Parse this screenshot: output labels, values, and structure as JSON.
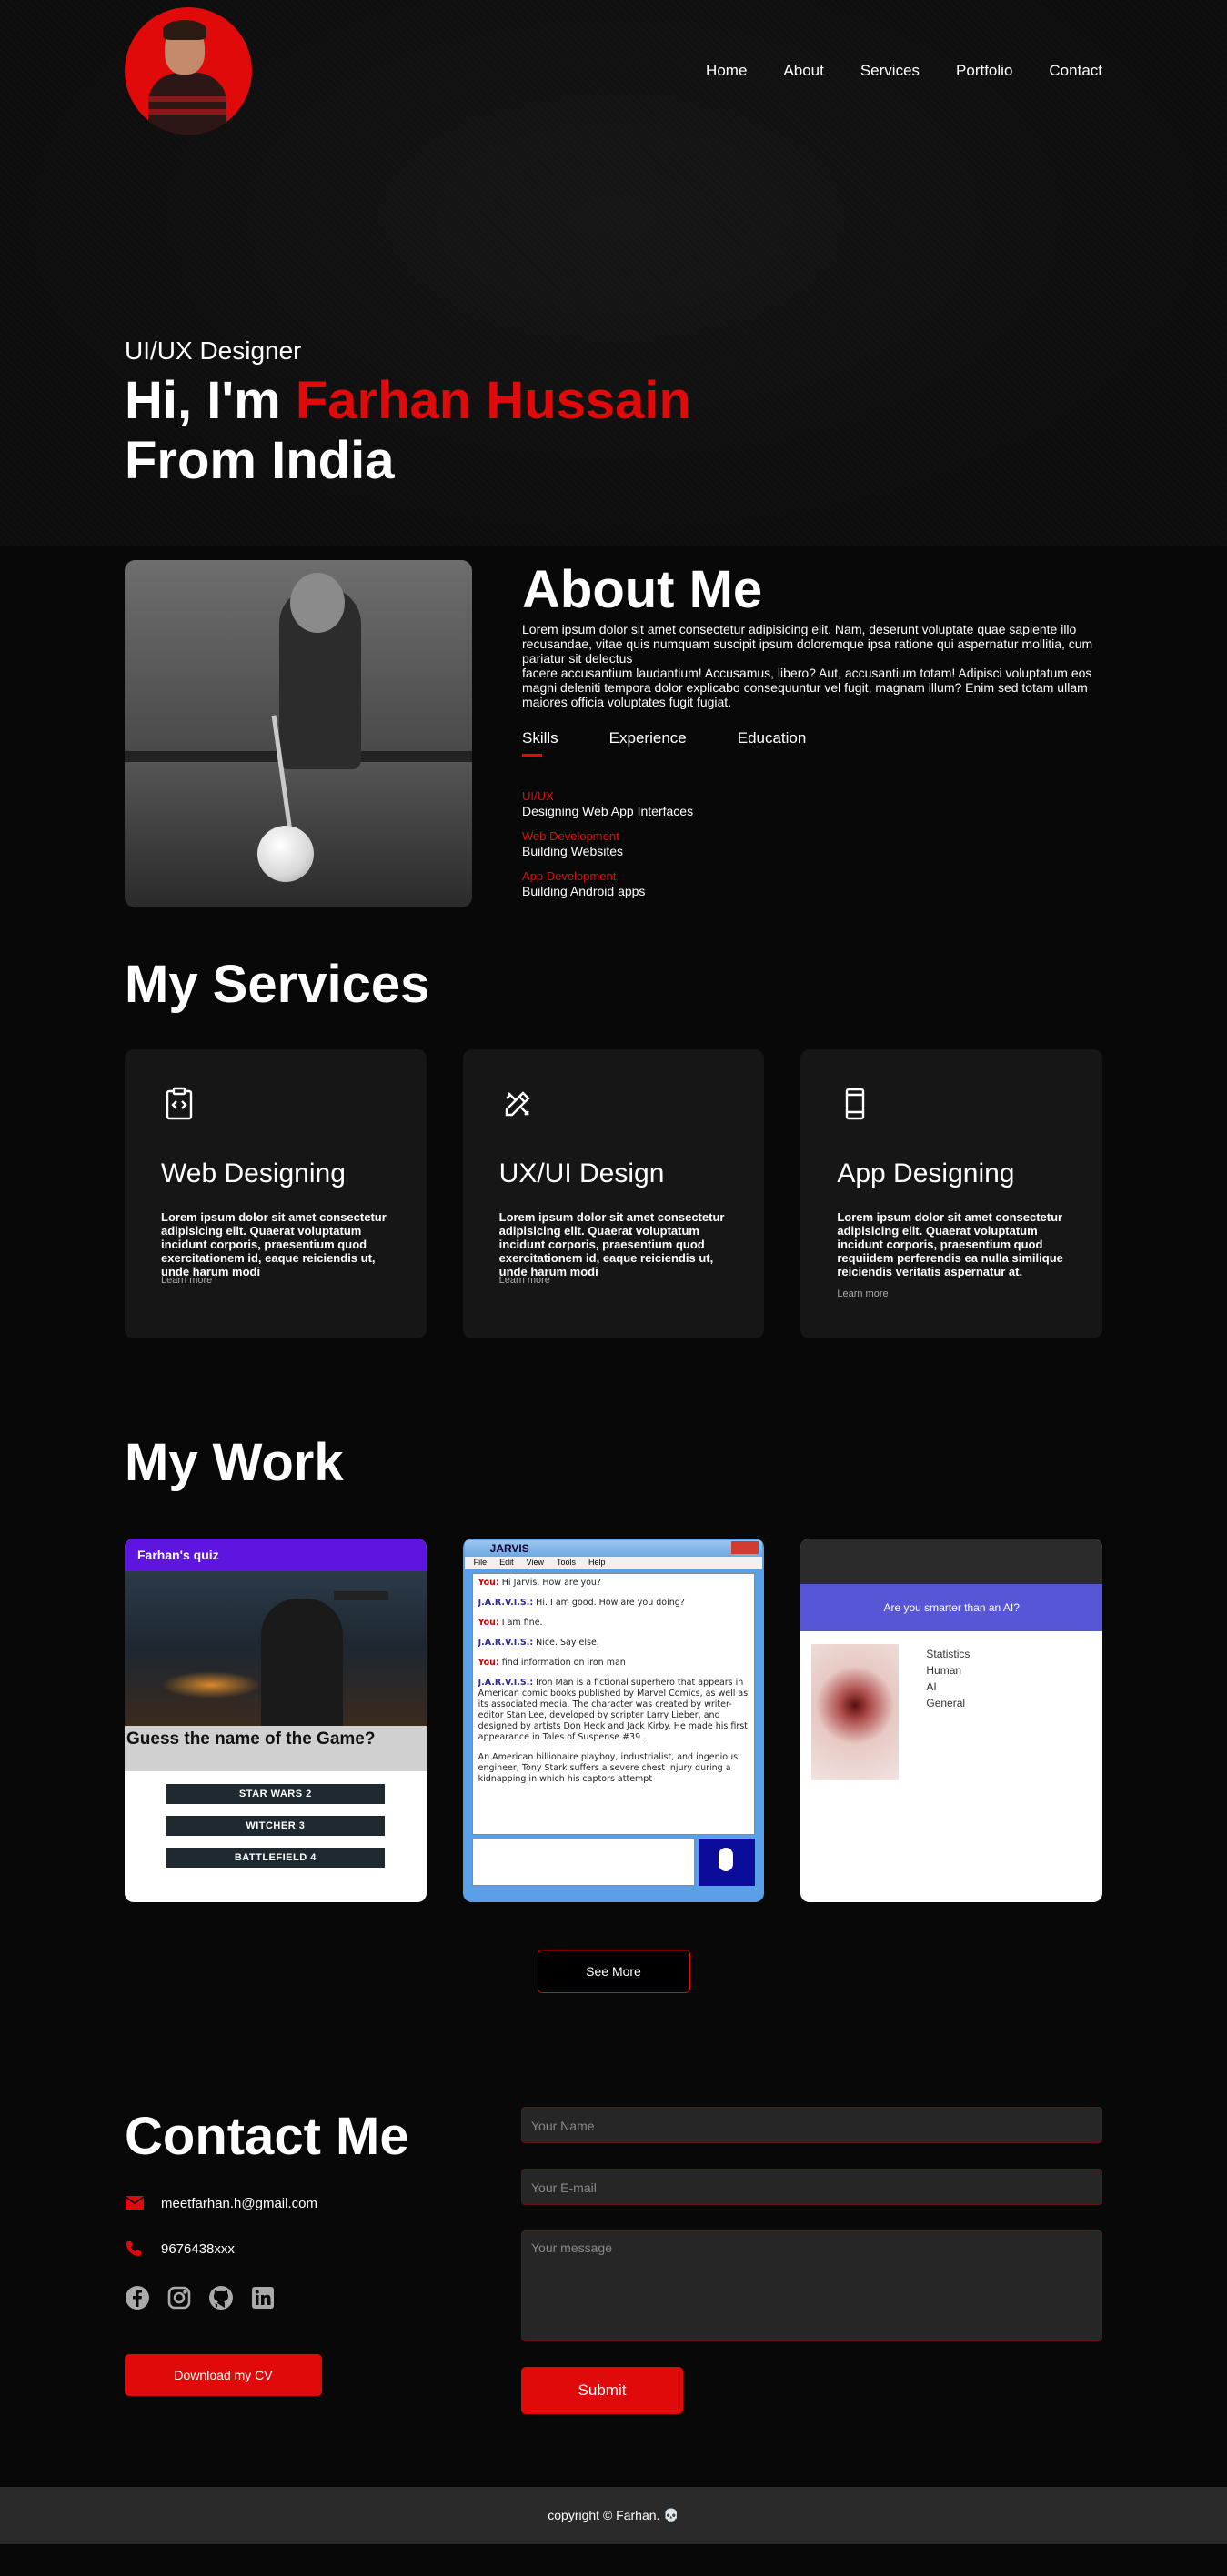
{
  "nav": {
    "items": [
      "Home",
      "About",
      "Services",
      "Portfolio",
      "Contact"
    ]
  },
  "hero": {
    "role": "UI/UX Designer",
    "greeting": "Hi, I'm ",
    "name": "Farhan Hussain",
    "location": "From India"
  },
  "about": {
    "title": "About Me",
    "text": "Lorem ipsum dolor sit amet consectetur adipisicing elit. Nam, deserunt voluptate quae sapiente illo recusandae, vitae quis numquam suscipit ipsum doloremque ipsa ratione qui aspernatur mollitia, cum pariatur sit delectus\nfacere accusantium laudantium! Accusamus, libero? Aut, accusantium totam! Adipisci voluptatum eos magni deleniti tempora dolor explicabo consequuntur vel fugit, magnam illum? Enim sed totam ullam maiores officia voluptates fugit fugiat.",
    "tabs": [
      "Skills",
      "Experience",
      "Education"
    ],
    "skills": [
      {
        "title": "UI/UX",
        "desc": "Designing Web App Interfaces"
      },
      {
        "title": "Web Development",
        "desc": "Building Websites"
      },
      {
        "title": "App Development",
        "desc": "Building Android apps"
      }
    ]
  },
  "services": {
    "title": "My Services",
    "cards": [
      {
        "icon": "code-file-icon",
        "title": "Web Designing",
        "text": "Lorem ipsum dolor sit amet consectetur adipisicing elit. Quaerat voluptatum incidunt corporis, praesentium quod exercitationem id, eaque reiciendis ut, unde harum modi",
        "link": "Learn more"
      },
      {
        "icon": "design-tools-icon",
        "title": "UX/UI Design",
        "text": "Lorem ipsum dolor sit amet consectetur adipisicing elit. Quaerat voluptatum incidunt corporis, praesentium quod exercitationem id, eaque reiciendis ut, unde harum modi",
        "link": "Learn more"
      },
      {
        "icon": "mobile-phone-icon",
        "title": "App Designing",
        "text": "Lorem ipsum dolor sit amet consectetur adipisicing elit. Quaerat voluptatum incidunt corporis, praesentium quod requiidem perferendis ea nulla similique reiciendis veritatis aspernatur at.",
        "link": "Learn more"
      }
    ]
  },
  "work": {
    "title": "My Work",
    "quiz": {
      "header": "Farhan's quiz",
      "question": "Guess the name of the Game?",
      "options": [
        "STAR WARS 2",
        "WITCHER 3",
        "BATTLEFIELD 4"
      ]
    },
    "jarvis": {
      "title": "JARVIS",
      "menu": [
        "File",
        "Edit",
        "View",
        "Tools",
        "Help"
      ],
      "messages": [
        {
          "who": "You:",
          "text": " Hi Jarvis. How are you?"
        },
        {
          "who": "J.A.R.V.I.S.:",
          "text": " Hi. I am good. How are you doing?"
        },
        {
          "who": "You:",
          "text": " I am fine."
        },
        {
          "who": "J.A.R.V.I.S.:",
          "text": " Nice. Say else."
        },
        {
          "who": "You:",
          "text": " find information on iron man"
        },
        {
          "who": "J.A.R.V.I.S.:",
          "text": " Iron Man is a fictional superhero that appears in American comic books published by Marvel Comics, as well as its associated media. The character was created by writer-editor Stan Lee, developed by scripter Larry Lieber, and designed by artists Don Heck and Jack Kirby. He made his first appearance in Tales of Suspense #39 ."
        },
        {
          "who": "",
          "text": "An American billionaire playboy, industrialist, and ingenious engineer, Tony Stark suffers a severe chest injury during a kidnapping in which his captors attempt"
        }
      ]
    },
    "ai": {
      "banner": "Are you smarter than an AI?",
      "stats_title": "Statistics",
      "groups": [
        "Human",
        "AI",
        "General"
      ]
    },
    "see_more": "See More"
  },
  "contact": {
    "title": "Contact Me",
    "email": "meetfarhan.h@gmail.com",
    "phone": "9676438xxx",
    "socials": [
      "facebook-icon",
      "instagram-icon",
      "github-icon",
      "linkedin-icon"
    ],
    "cv_button": "Download my CV",
    "form": {
      "name_placeholder": "Your Name",
      "email_placeholder": "Your E-mail",
      "message_placeholder": "Your message",
      "submit": "Submit"
    }
  },
  "footer": {
    "text": "copyright © Farhan. 💀"
  },
  "colors": {
    "accent": "#e10a0a",
    "background": "#080808",
    "card": "#161616"
  }
}
